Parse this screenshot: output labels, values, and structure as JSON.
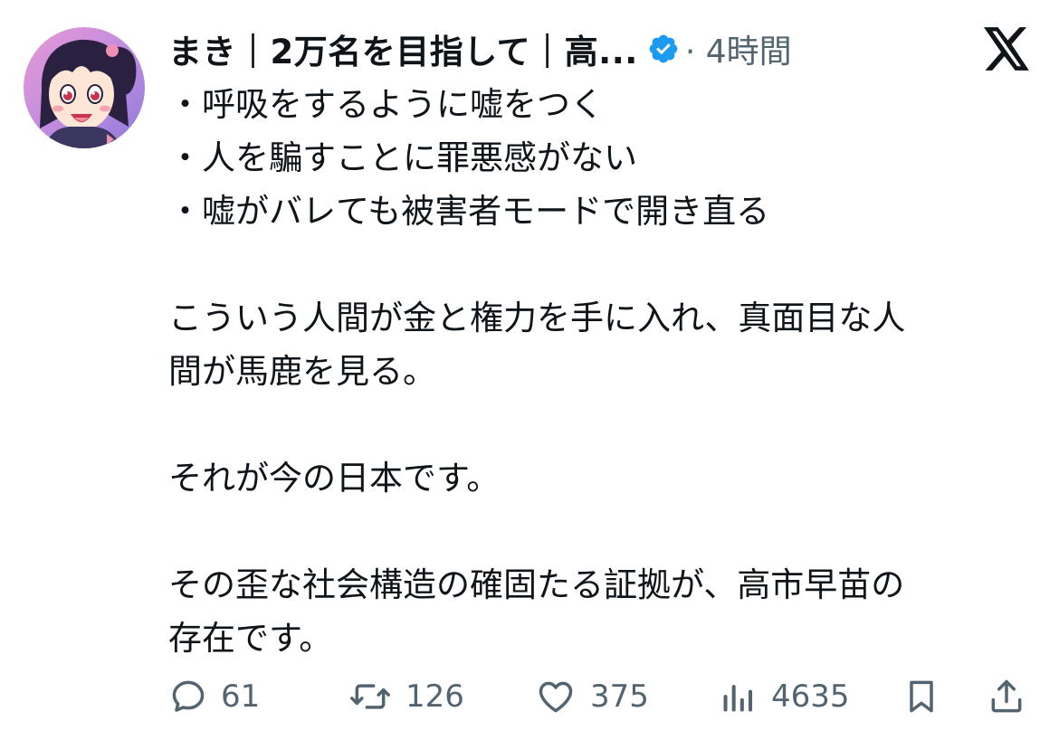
{
  "post": {
    "author": {
      "display_name": "まき｜2万名を目指して｜高...",
      "verified_icon": "verified-badge-icon",
      "time_label": "· 4時間"
    },
    "platform_icon": "x-logo-icon",
    "lines": [
      "・呼吸をするように嘘をつく",
      "・人を騙すことに罪悪感がない",
      "・嘘がバレても被害者モードで開き直る",
      "",
      "こういう人間が金と権力を手に入れ、真面目な人",
      "間が馬鹿を見る。",
      "",
      "それが今の日本です。",
      "",
      "その歪な社会構造の確固たる証拠が、高市早苗の",
      "存在です。"
    ],
    "actions": {
      "reply": {
        "icon": "reply-icon",
        "count": "61"
      },
      "repost": {
        "icon": "repost-icon",
        "count": "126"
      },
      "like": {
        "icon": "heart-icon",
        "count": "375"
      },
      "views": {
        "icon": "views-chart-icon",
        "count": "4635"
      },
      "bookmark": {
        "icon": "bookmark-icon"
      },
      "share": {
        "icon": "share-icon"
      }
    },
    "colors": {
      "text": "#0f1419",
      "secondary": "#536471",
      "verified": "#1d9bf0"
    }
  }
}
